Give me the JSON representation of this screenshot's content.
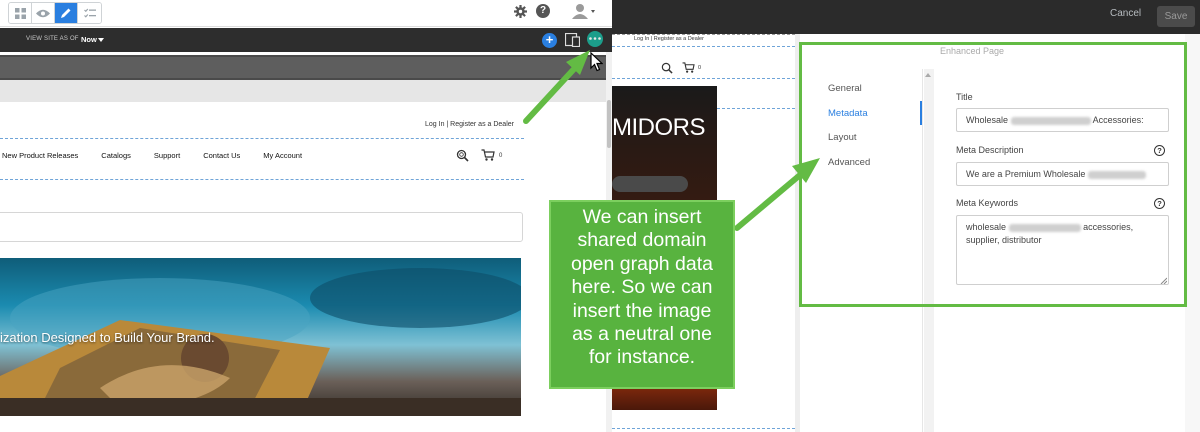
{
  "toolbar": {
    "icons": [
      "grid-icon",
      "eye-icon",
      "pencil-icon",
      "checklist-icon"
    ],
    "active": "pencil-icon",
    "right_icons": [
      "gear-icon",
      "help-icon",
      "user-icon"
    ]
  },
  "header": {
    "cancel_label": "Cancel",
    "save_label": "Save",
    "view_site_label": "VIEW SITE AS OF",
    "view_site_value": "Now"
  },
  "site": {
    "login_text": "Log In | Register as a Dealer",
    "nav_items": [
      "New Product Releases",
      "Catalogs",
      "Support",
      "Contact Us",
      "My Account"
    ],
    "cart_count": "0",
    "hero_text": "ization Designed to Build Your Brand.",
    "mid_heading": "MIDORS"
  },
  "dialog": {
    "title": "Enhanced Page",
    "tabs": [
      {
        "label": "General"
      },
      {
        "label": "Metadata"
      },
      {
        "label": "Layout"
      },
      {
        "label": "Advanced"
      }
    ],
    "active_tab": "Metadata",
    "fields": {
      "title_label": "Title",
      "title_value_start": "Wholesale",
      "title_value_end": "Accessories:",
      "meta_description_label": "Meta Description",
      "meta_description_value": "We are a Premium Wholesale",
      "meta_keywords_label": "Meta Keywords",
      "meta_keywords_start": "wholesale",
      "meta_keywords_mid": "accessories,",
      "meta_keywords_line2": "supplier, distributor",
      "help_glyph": "?"
    }
  },
  "annotation": {
    "lines": [
      "We can insert",
      "shared domain",
      "open graph data",
      "here. So we can",
      "insert the image",
      "as a neutral one",
      "for instance."
    ]
  },
  "colors": {
    "accent": "#2a7fe0",
    "annotation_green": "#58b33f",
    "highlight_green": "#63bb44"
  }
}
